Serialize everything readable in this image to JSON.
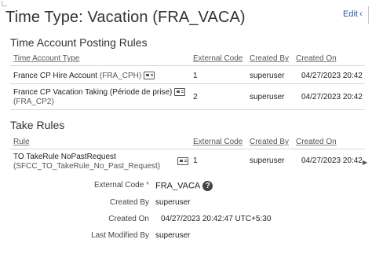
{
  "header": {
    "title": "Time Type: Vacation (FRA_VACA)",
    "edit_label": "Edit",
    "more_label": "‹"
  },
  "account_rules": {
    "section_title": "Time Account Posting Rules",
    "columns": [
      "Time Account Type",
      "External Code",
      "Created By",
      "Created On"
    ],
    "rows": [
      {
        "name": "France CP Hire Account",
        "code": "(FRA_CPH)",
        "external_code": "1",
        "created_by": "superuser",
        "created_on": "04/27/2023 20:42"
      },
      {
        "name": "France CP Vacation Taking (Période de prise)",
        "code": "(FRA_CP2)",
        "external_code": "2",
        "created_by": "superuser",
        "created_on": "04/27/2023 20:42"
      }
    ]
  },
  "take_rules": {
    "section_title": "Take Rules",
    "columns": [
      "Rule",
      "External Code",
      "Created By",
      "Created On"
    ],
    "rows": [
      {
        "name": "TO TakeRule  NoPastRequest",
        "code": "(SFCC_TO_TakeRule_No_Past_Request)",
        "external_code": "1",
        "created_by": "superuser",
        "created_on": "04/27/2023 20:42"
      }
    ]
  },
  "details": {
    "external_code_label": "External Code",
    "required_mark": "*",
    "external_code_value": "FRA_VACA",
    "created_by_label": "Created By",
    "created_by_value": "superuser",
    "created_on_label": "Created On",
    "created_on_value": "04/27/2023 20:42:47 UTC+5:30",
    "last_modified_label": "Last Modified By",
    "last_modified_value": "superuser"
  },
  "icons": {
    "help": "?",
    "scroll_right": "▶"
  }
}
